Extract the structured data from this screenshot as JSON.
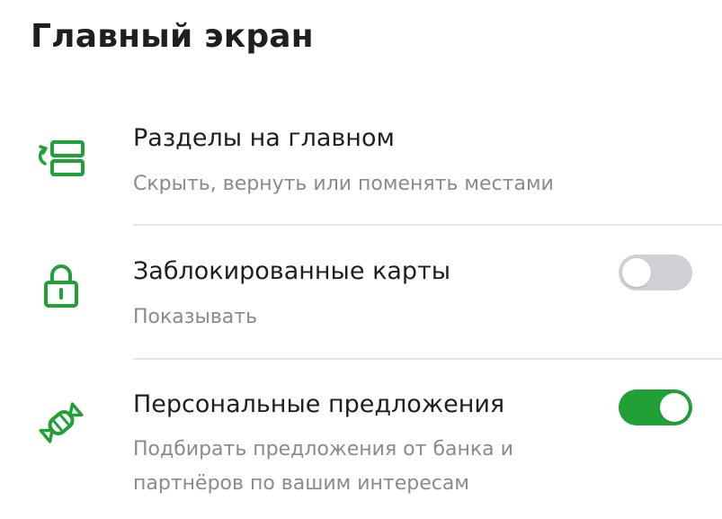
{
  "colors": {
    "accent": "#21a038",
    "toggle_off": "#d0d0d4",
    "subtitle": "#8a8a8f"
  },
  "screen": {
    "title": "Главный экран"
  },
  "items": [
    {
      "icon": "sections-reorder-icon",
      "title": "Разделы на главном",
      "subtitle": "Скрыть, вернуть или поменять местами"
    },
    {
      "icon": "lock-icon",
      "title": "Заблокированные карты",
      "subtitle": "Показывать",
      "toggle_on": false
    },
    {
      "icon": "candy-icon",
      "title": "Персональные предложения",
      "subtitle_line1": "Подбирать предложения от банка и",
      "subtitle_line2": "партнёров по вашим интересам",
      "toggle_on": true
    }
  ]
}
